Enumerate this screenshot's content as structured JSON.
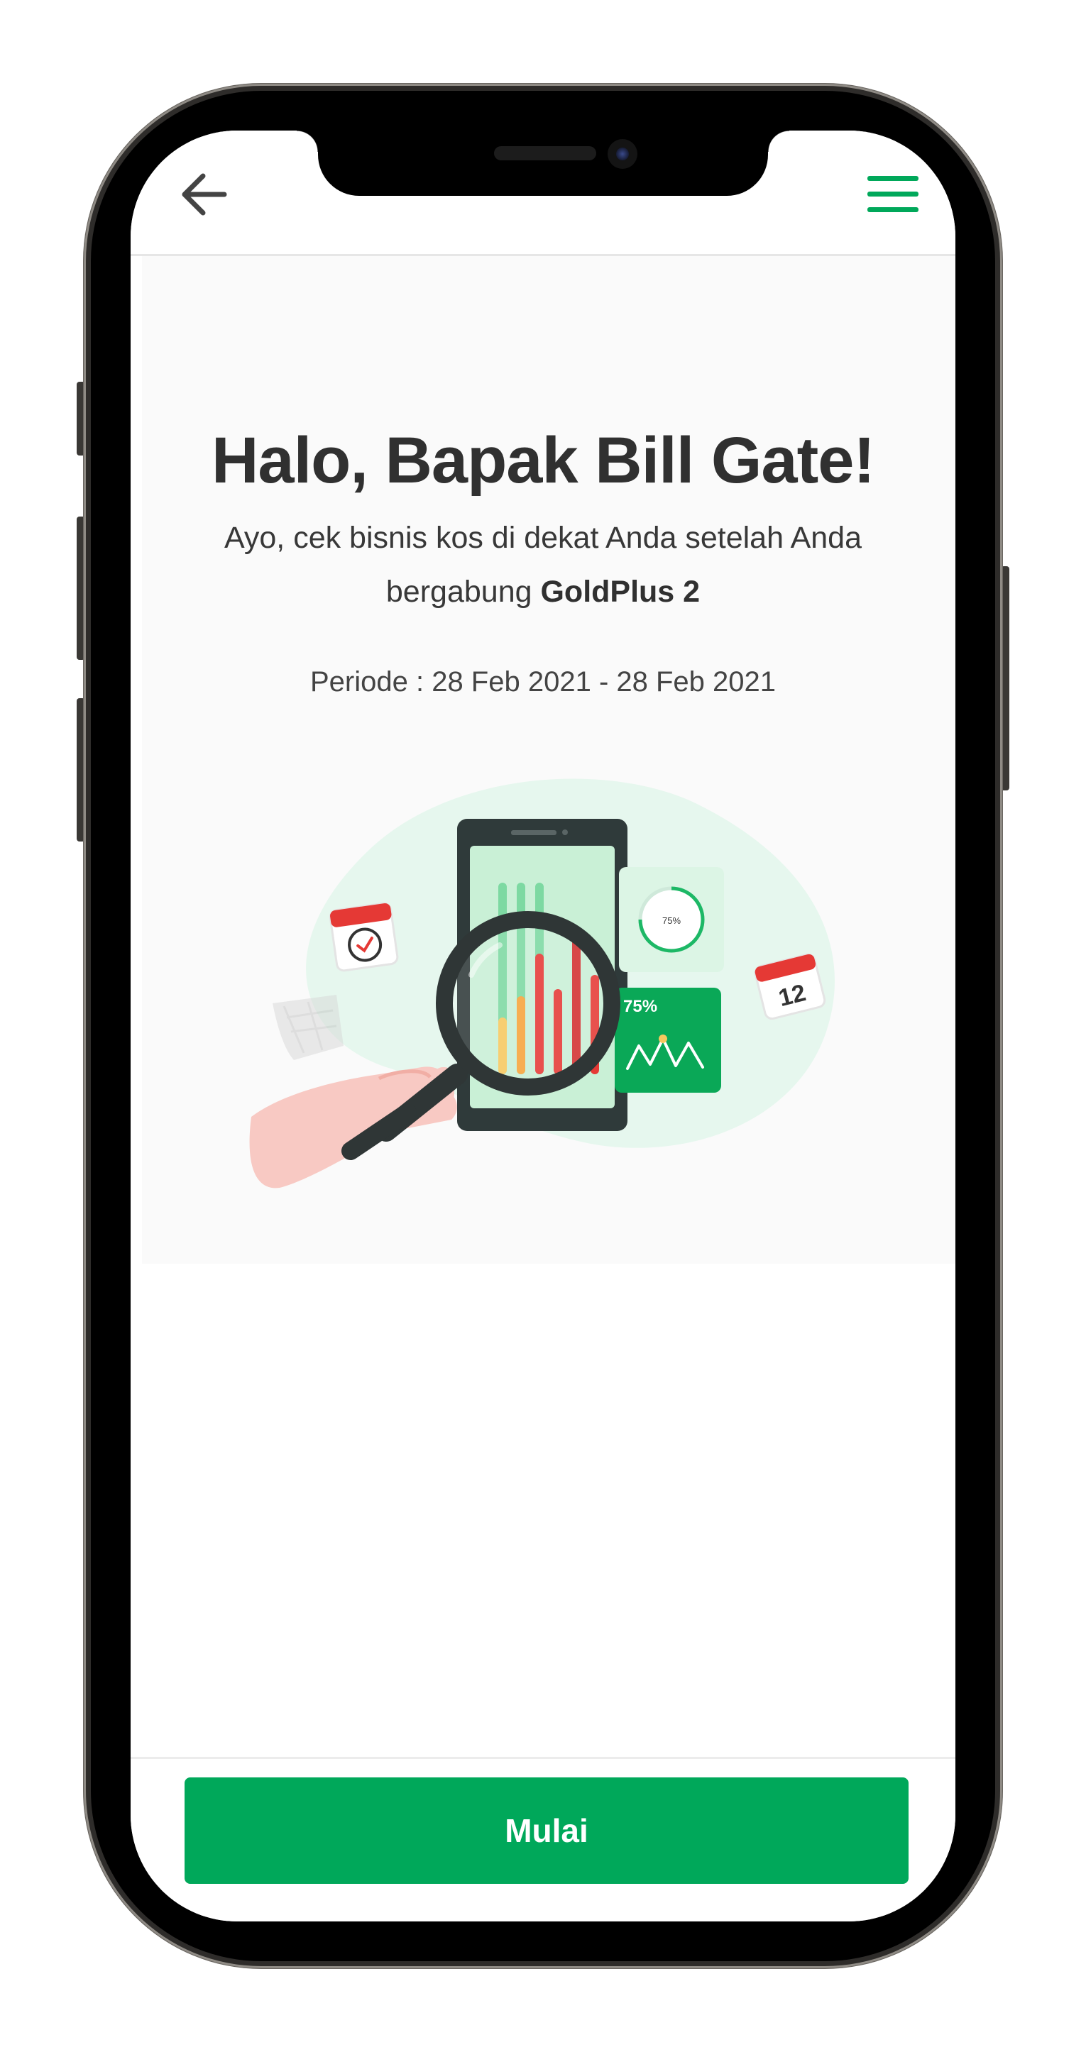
{
  "header": {
    "back_icon": "arrow-left-icon",
    "menu_icon": "hamburger-menu-icon",
    "accent_color": "#00a85a"
  },
  "main": {
    "greeting": "Halo, Bapak Bill Gate!",
    "subtitle_prefix": "Ayo, cek bisnis kos di dekat Anda setelah Anda bergabung ",
    "subtitle_bold": "GoldPlus 2",
    "period": "Periode : 28 Feb 2021 - 28 Feb 2021"
  },
  "illustration": {
    "subject": "hand-with-magnifier-over-phone-analytics",
    "gauge_label": "75%",
    "card_label": "75%",
    "calendar_day": "12"
  },
  "footer": {
    "start_label": "Mulai",
    "button_color": "#00a85a"
  }
}
